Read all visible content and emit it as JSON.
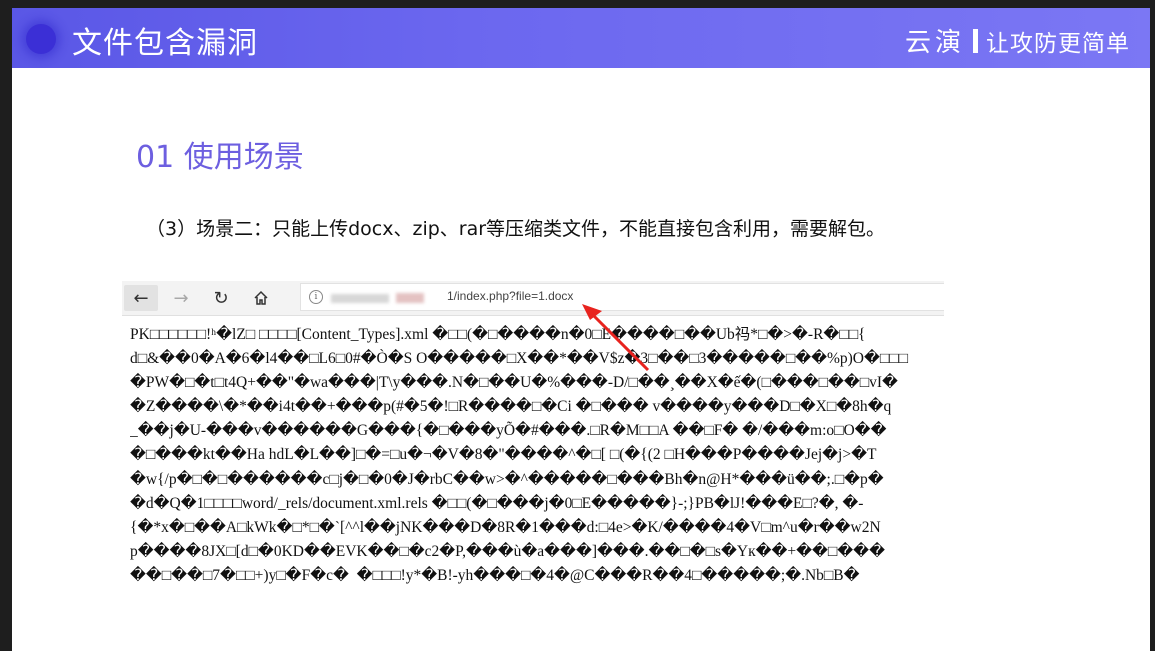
{
  "header": {
    "title": "文件包含漏洞",
    "brand_name": "云演",
    "brand_slogan": "让攻防更简单"
  },
  "section": {
    "title": "01 使用场景",
    "text": "（3）场景二：只能上传docx、zip、rar等压缩类文件，不能直接包含利用，需要解包。"
  },
  "browser": {
    "url": "1/index.php?file=1.docx",
    "content_lines": [
      "PK□□□□□□!ʰ�lZ□ □□□□[Content_Types].xml �□□(�□����n�0□E����□��Ub祃*□�>�-R�□□{",
      "d□&��0�A�6�l4��□L6□0#�Ò�S O�����□X��*��V$z�3□��□3�����□��%p)O�□□□",
      "�PW�□�t□t4Q+��\"�wa���|T\\y���.N�□��U�%���-D/□��¸��X�ế�(□���□��□vI�",
      "�Z����\\�*��i4t��+���p(#�5�!□R����□�Ci �□��� v����y���D□�X□�8h�q",
      "_��j�U-���v������G���{�□���yÕ�#���.□R�M□□A ��□F� �/���m:o□O��",
      "�□���kt��Ha hdL�L��]□�=□u�¬�V�8�\"����^�□[ □(�{(2 □H���P����Jej�j>�T",
      "�w{/p�□�□������c□j�□�0�J�rbC��w>�^�����□���Bh�n@H*���ü��;.□�p�",
      "�d�Q�1□□□□word/_rels/document.xml.rels �□□(�□���j�0□E�����}-;}PB�lJ!���E□?�, �-",
      "{�*x�□��A□kWk�□*□�`[^^l��jNK���D�8R�1���d:□4e>�K/����4�V□m^u�r��w2N",
      "p����8JX□[d□�0KD��EVK��□�c2�P,���ù�a���]���.��□�□s�Yк��+��□���",
      "��□��□7�□□+)y□�F�c�  �□□□!y*�B!-yh���□�4�@C���R��4□�����;�.Nb□B�"
    ]
  }
}
